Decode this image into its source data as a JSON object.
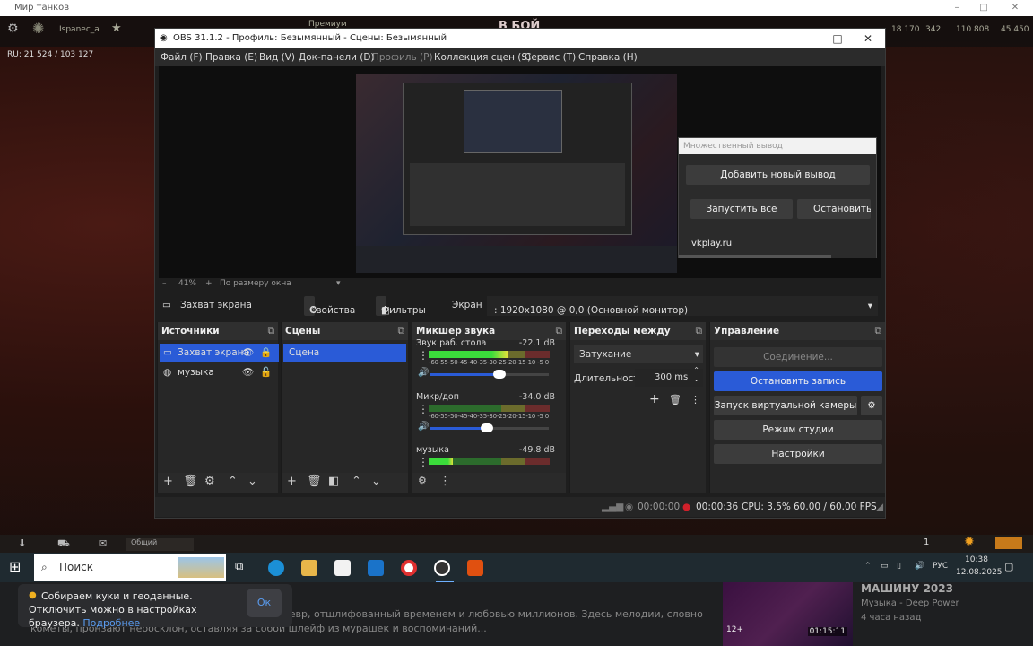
{
  "game": {
    "window_title": "Мир танков",
    "player": "Ispanec_a",
    "battle": "В БОЙ",
    "mode": "Премиум",
    "stats": "RU: 21 524 / 103 127",
    "gold": "18 170",
    "bonds": "342",
    "credits": "110 808",
    "free": "45 450",
    "chat_label": "Общий",
    "queue_count": "1"
  },
  "obs": {
    "title": "OBS 31.1.2 - Профиль: Безымянный - Сцены: Безымянный",
    "menu": [
      "Файл (F)",
      "Правка (E)",
      "Вид (V)",
      "Док-панели (D)",
      "Профиль (P)",
      "Коллекция сцен (S)",
      "Сервис (T)",
      "Справка (H)"
    ],
    "multi_output": {
      "title": "Множественный вывод",
      "add": "Добавить новый вывод",
      "start_all": "Запустить все",
      "stop_all": "Остановить в",
      "target": "vkplay.ru"
    },
    "zoom": "41%",
    "fit": "По размеру окна",
    "source_toolbar": {
      "source": "Захват экрана",
      "properties": "Свойства",
      "filters": "Фильтры",
      "screen_label": "Экран",
      "screen_value": ": 1920x1080 @ 0,0 (Основной монитор)"
    },
    "sources": {
      "title": "Источники",
      "items": [
        "Захват экрана",
        "музыка"
      ]
    },
    "scenes": {
      "title": "Сцены",
      "items": [
        "Сцена"
      ]
    },
    "mixer": {
      "title": "Микшер звука",
      "ticks": "-60-55-50-45-40-35-30-25-20-15-10 -5 0",
      "channels": [
        {
          "name": "Звук раб. стола",
          "db": "-22.1 dB",
          "level": 0.65,
          "volume": 0.58
        },
        {
          "name": "Микр/доп",
          "db": "-34.0 dB",
          "level": 0.0,
          "volume": 0.48
        },
        {
          "name": "музыка",
          "db": "-49.8 dB",
          "level": 0.2,
          "volume": 0.5
        }
      ]
    },
    "transitions": {
      "title": "Переходы между сцен...",
      "type": "Затухание",
      "duration_label": "Длительность",
      "duration": "300 ms"
    },
    "controls": {
      "title": "Управление",
      "connect": "Соединение...",
      "stop_record": "Остановить запись",
      "virtual_cam": "Запуск виртуальной камеры",
      "studio": "Режим студии",
      "settings": "Настройки"
    },
    "status": {
      "stream_time": "00:00:00",
      "rec_time": "00:00:36",
      "cpu": "CPU: 3.5%",
      "fps": "60.00 / 60.00 FPS"
    }
  },
  "taskbar": {
    "search": "Поиск",
    "lang": "РУС",
    "time": "10:38",
    "date": "12.08.2025"
  },
  "browser": {
    "cookie_text": "Собираем куки и геоданные. Отключить можно в настройках браузера.",
    "cookie_link": "Подробнее",
    "ok": "Ок",
    "desc": "где каждая волна – это хит, а каждый риф – шедевр, отшлифованный временем и любовью миллионов. Здесь мелодии, словно кометы, пронзают небосклон, оставляя за собой шлейф из мурашек и воспоминаний...",
    "video_title": "МАШИНУ 2023",
    "video_channel": "Музыка - Deep Power",
    "video_time": "4 часа назад",
    "duration": "01:15:11",
    "age": "12+"
  },
  "colors": {
    "accent": "#2a5bd7",
    "record": "#d0202a"
  }
}
